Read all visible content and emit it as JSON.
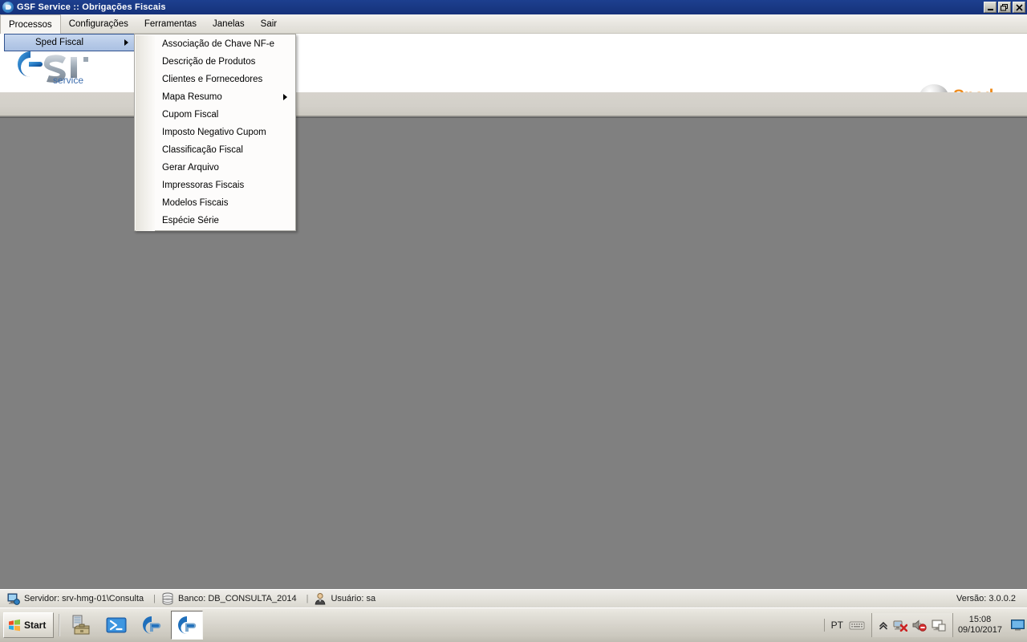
{
  "window": {
    "title": "GSF Service :: Obrigações Fiscais",
    "icon": "gsf-logo-icon",
    "minimize_label": "Minimizar",
    "restore_label": "Restaurar",
    "close_label": "Fechar"
  },
  "menubar": {
    "items": [
      {
        "label": "Processos",
        "open": true
      },
      {
        "label": "Configurações",
        "open": false
      },
      {
        "label": "Ferramentas",
        "open": false
      },
      {
        "label": "Janelas",
        "open": false
      },
      {
        "label": "Sair",
        "open": false
      }
    ]
  },
  "dropdown": {
    "items": [
      {
        "label": "Sped Fiscal",
        "has_submenu": true,
        "highlighted": true
      }
    ]
  },
  "submenu": {
    "items": [
      {
        "label": "Associação de Chave NF-e",
        "has_submenu": false
      },
      {
        "label": "Descrição de Produtos",
        "has_submenu": false
      },
      {
        "label": "Clientes e Fornecedores",
        "has_submenu": false
      },
      {
        "label": "Mapa Resumo",
        "has_submenu": true
      },
      {
        "label": "Cupom Fiscal",
        "has_submenu": false
      },
      {
        "label": "Imposto Negativo Cupom",
        "has_submenu": false
      },
      {
        "label": "Classificação Fiscal",
        "has_submenu": false
      },
      {
        "label": "Gerar Arquivo",
        "has_submenu": false
      },
      {
        "label": "Impressoras Fiscais",
        "has_submenu": false
      },
      {
        "label": "Modelos Fiscais",
        "has_submenu": false
      },
      {
        "label": "Espécie Série",
        "has_submenu": false
      }
    ]
  },
  "header": {
    "brand_logo": "gsf-service-logo",
    "brand_text": "GSF",
    "brand_subtext": "service",
    "sped_logo": "sped-logo",
    "sped_text": "Sped"
  },
  "statusbar": {
    "server_icon": "server-icon",
    "server": "Servidor: srv-hmg-01\\Consulta",
    "sep1": "|",
    "database_icon": "database-icon",
    "database": "Banco: DB_CONSULTA_2014",
    "sep2": "|",
    "user_icon": "user-icon",
    "user": "Usuário: sa",
    "version": "Versão: 3.0.0.2"
  },
  "taskbar": {
    "start_label": "Start",
    "quicklaunch": [
      {
        "name": "server-toolbox-icon",
        "active": false
      },
      {
        "name": "powershell-icon",
        "active": false
      },
      {
        "name": "gsf-app-icon",
        "active": false
      },
      {
        "name": "gsf-app-icon-active",
        "active": true
      }
    ],
    "language": "PT",
    "keyboard_icon": "keyboard-icon",
    "tray_icons": [
      "show-hidden-icons-chevron",
      "network-disconnected-icon",
      "volume-muted-icon",
      "display-icon"
    ],
    "clock_time": "15:08",
    "clock_date": "09/10/2017",
    "show_desktop_icon": "show-desktop-icon"
  },
  "colors": {
    "titlebar": "#1a3a86",
    "menubar": "#e8e6e0",
    "mdi_background": "#808080",
    "accent_orange": "#ee8c1e",
    "accent_blue": "#1f6fbb",
    "highlight_blue": "#b8cbe8"
  }
}
